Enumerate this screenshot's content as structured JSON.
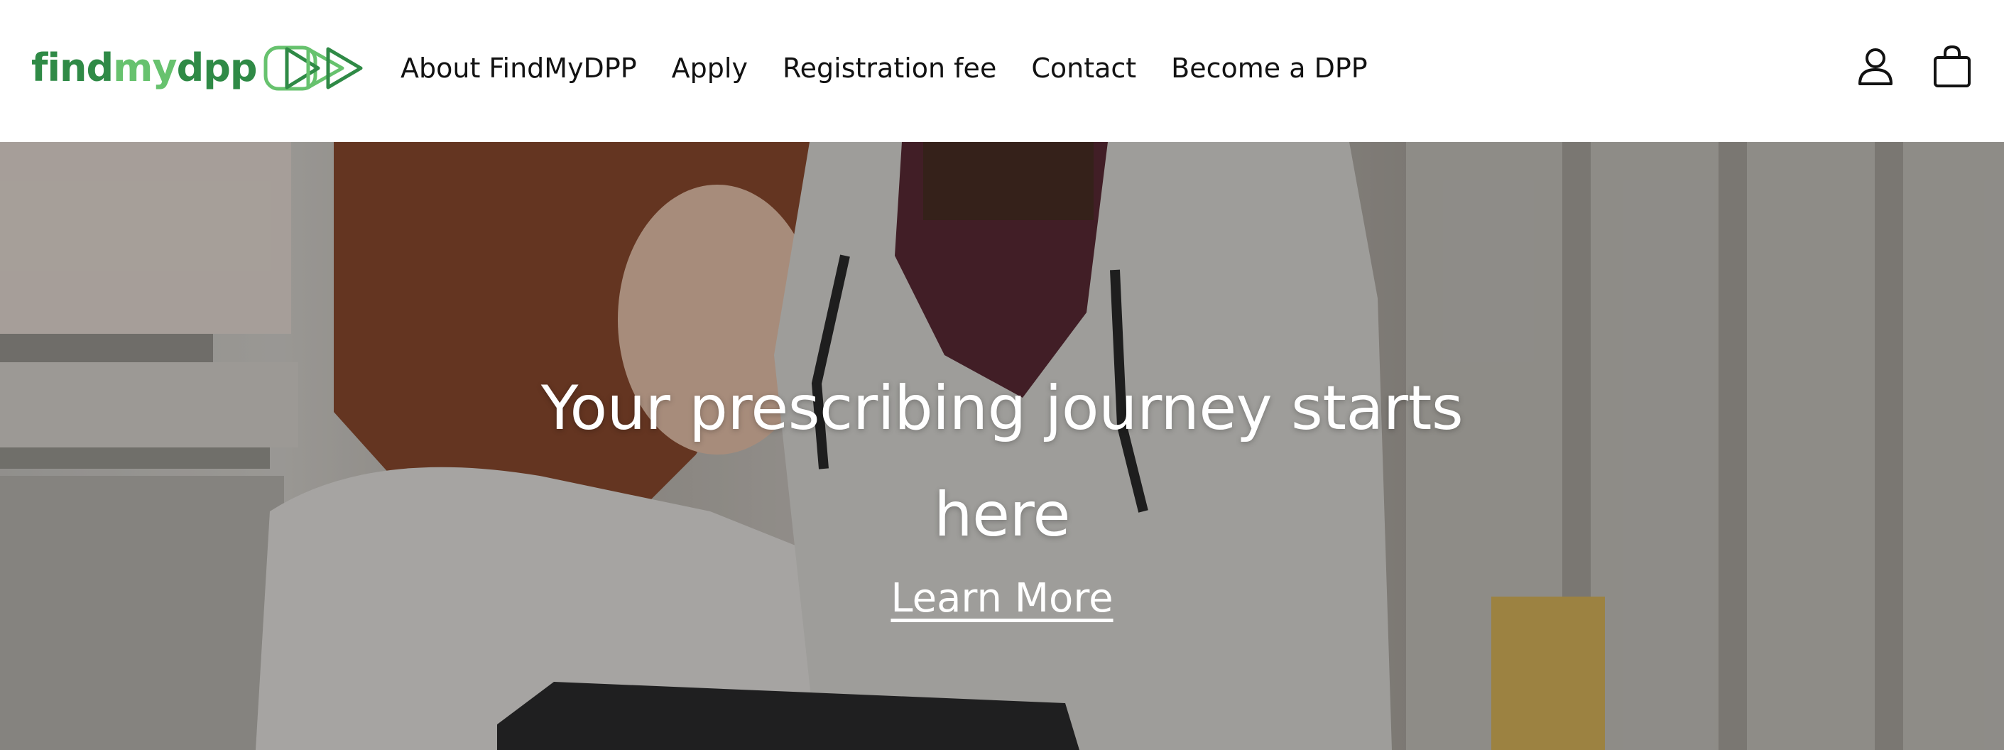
{
  "header": {
    "logo": {
      "text_find": "find",
      "text_my": "my",
      "text_dpp": "dpp",
      "icon": "double-play-icon"
    },
    "nav": [
      {
        "label": "About FindMyDPP"
      },
      {
        "label": "Apply"
      },
      {
        "label": "Registration fee"
      },
      {
        "label": "Contact"
      },
      {
        "label": "Become a DPP"
      }
    ],
    "icons": [
      "account-icon",
      "cart-icon"
    ]
  },
  "hero": {
    "title": "Your prescribing journey starts here",
    "link": "Learn More"
  },
  "colors": {
    "brand_dark_green": "#2f8a46",
    "brand_light_green": "#67c26e",
    "nav_text": "#121212",
    "hero_text": "#ffffff"
  }
}
